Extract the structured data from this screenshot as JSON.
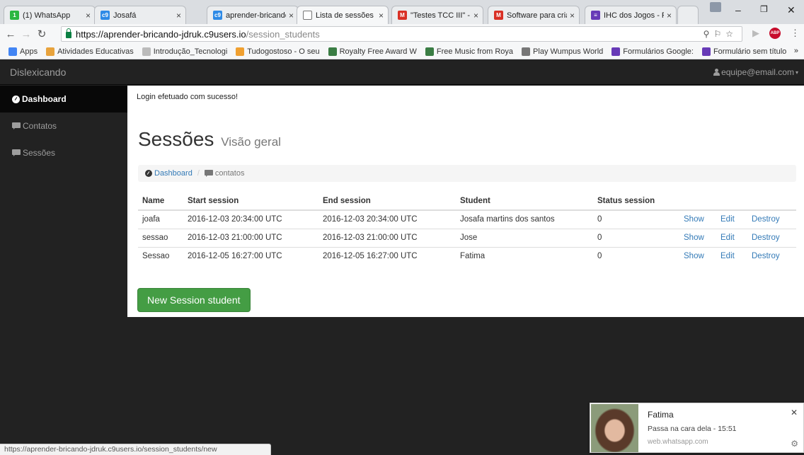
{
  "browser": {
    "tabs": [
      {
        "title": "(1) WhatsApp",
        "favicon_color": "#2bb741",
        "favicon_glyph": "1"
      },
      {
        "title": "Josafá",
        "favicon_color": "#2e8ae6",
        "favicon_glyph": "c9"
      },
      {
        "title": "aprender-bricando",
        "favicon_color": "#2e8ae6",
        "favicon_glyph": "c9"
      },
      {
        "title": "Lista de sessões do",
        "favicon_color": "#ffffff",
        "favicon_glyph": ""
      },
      {
        "title": "\"Testes TCC III\" - ja",
        "favicon_color": "#d93025",
        "favicon_glyph": "M"
      },
      {
        "title": "Software para criar",
        "favicon_color": "#d93025",
        "favicon_glyph": "M"
      },
      {
        "title": "IHC dos Jogos - Fo",
        "favicon_color": "#673ab7",
        "favicon_glyph": "≡"
      }
    ],
    "url_host": "https://aprender-bricando-jdruk.c9users.io",
    "url_path": "/session_students",
    "bookmarks": [
      {
        "label": "Apps",
        "color": "#4285f4"
      },
      {
        "label": "Atividades Educativas",
        "color": "#e8a33d"
      },
      {
        "label": "Introdução_Tecnologi",
        "color": "#bbbbbb"
      },
      {
        "label": "Tudogostoso - O seu",
        "color": "#f0a030"
      },
      {
        "label": "Royalty Free Award W",
        "color": "#3a7d44"
      },
      {
        "label": "Free Music from Roya",
        "color": "#3a7d44"
      },
      {
        "label": "Play Wumpus World",
        "color": "#777777"
      },
      {
        "label": "Formulários Google: ",
        "color": "#673ab7"
      },
      {
        "label": "Formulário sem título",
        "color": "#673ab7"
      }
    ],
    "bookmarks_more": "»",
    "status_url": "https://aprender-bricando-jdruk.c9users.io/session_students/new"
  },
  "app": {
    "brand": "Dislexicando",
    "user_email": "equipe@email.com",
    "sidebar": [
      {
        "label": "Dashboard",
        "icon": "dashboard-icon",
        "active": true
      },
      {
        "label": "Contatos",
        "icon": "comment-icon",
        "active": false
      },
      {
        "label": "Sessões",
        "icon": "comment-icon",
        "active": false
      }
    ]
  },
  "main": {
    "alert": "Login efetuado com sucesso!",
    "title": "Sessões",
    "subtitle": "Visão geral",
    "breadcrumb": {
      "home": "Dashboard",
      "current": "contatos"
    },
    "table": {
      "headers": [
        "Name",
        "Start session",
        "End session",
        "Student",
        "Status session"
      ],
      "rows": [
        [
          "joafa",
          "2016-12-03 20:34:00 UTC",
          "2016-12-03 20:34:00 UTC",
          "Josafa martins dos santos",
          "0"
        ],
        [
          "sessao",
          "2016-12-03 21:00:00 UTC",
          "2016-12-03 21:00:00 UTC",
          "Jose",
          "0"
        ],
        [
          "Sessao",
          "2016-12-05 16:27:00 UTC",
          "2016-12-05 16:27:00 UTC",
          "Fatima",
          "0"
        ]
      ],
      "actions": [
        "Show",
        "Edit",
        "Destroy"
      ]
    },
    "new_button": "New Session student"
  },
  "notification": {
    "title": "Fatima",
    "body": "Passa na cara dela - 15:51",
    "source": "web.whatsapp.com"
  },
  "colors": {
    "success": "#449d44",
    "link": "#337ab7",
    "navbar": "#222222"
  }
}
